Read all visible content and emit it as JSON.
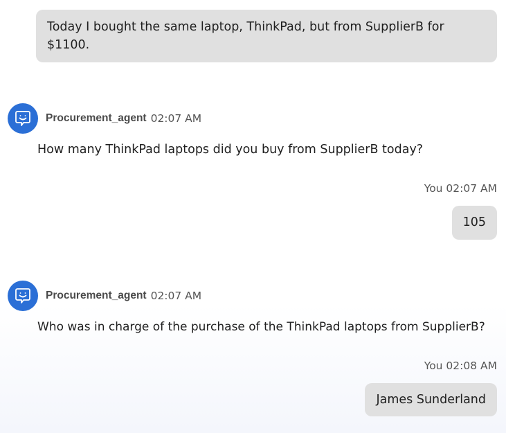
{
  "messages": [
    {
      "role": "user",
      "text": "Today I bought the same laptop, ThinkPad, but from SupplierB for $1100."
    },
    {
      "role": "agent",
      "name": "Procurement_agent",
      "time": "02:07 AM",
      "avatar_icon": "chatbot-icon",
      "text": "How many ThinkPad laptops did you buy from SupplierB today?"
    },
    {
      "role": "user",
      "meta": "You 02:07 AM",
      "text": "105"
    },
    {
      "role": "agent",
      "name": "Procurement_agent",
      "time": "02:07 AM",
      "avatar_icon": "chatbot-icon",
      "text": "Who was in charge of the purchase of the ThinkPad laptops from SupplierB?"
    },
    {
      "role": "user",
      "meta": "You 02:08 AM",
      "text": "James Sunderland"
    }
  ],
  "colors": {
    "avatar": "#2b6fd6",
    "user_bubble": "#e0e0e0"
  }
}
